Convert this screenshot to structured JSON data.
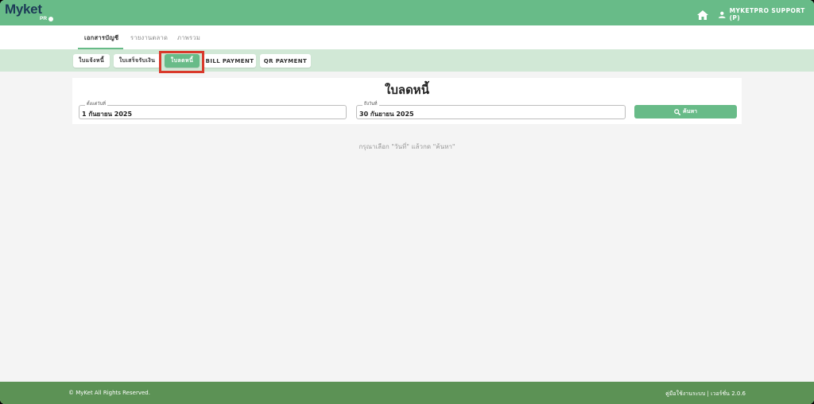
{
  "brand": {
    "name": "Myket",
    "sub": "PR"
  },
  "header": {
    "user_label": "MYKETPRO SUPPORT (P)"
  },
  "tabs": [
    {
      "label": "เอกสารบัญชี"
    },
    {
      "label": "รายงานตลาด"
    },
    {
      "label": "ภาพรวม"
    }
  ],
  "subtabs": [
    {
      "label": "ใบแจ้งหนี้"
    },
    {
      "label": "ใบเสร็จรับเงิน"
    },
    {
      "label": "ใบลดหนี้"
    },
    {
      "label": "BILL PAYMENT"
    },
    {
      "label": "QR PAYMENT"
    }
  ],
  "page": {
    "title": "ใบลดหนี้",
    "start_label": "ตั้งแต่วันที่",
    "start_value": "1 กันยายน 2025",
    "end_label": "ถึงวันที่",
    "end_value": "30 กันยายน 2025",
    "search_label": "ค้นหา",
    "hint": "กรุณาเลือก \"วันที่\" แล้วกด \"ค้นหา\""
  },
  "footer": {
    "copyright": "© MyKet All Rights Reserved.",
    "manual": "คู่มือใช้งานระบบ",
    "separator": "|",
    "version": "เวอร์ชั่น 2.0.6"
  },
  "colors": {
    "primary": "#68bb88",
    "sub_bar": "#d1e8d6",
    "footer": "#5c9255",
    "highlight": "#d9392b",
    "logo": "#1d3b57"
  }
}
